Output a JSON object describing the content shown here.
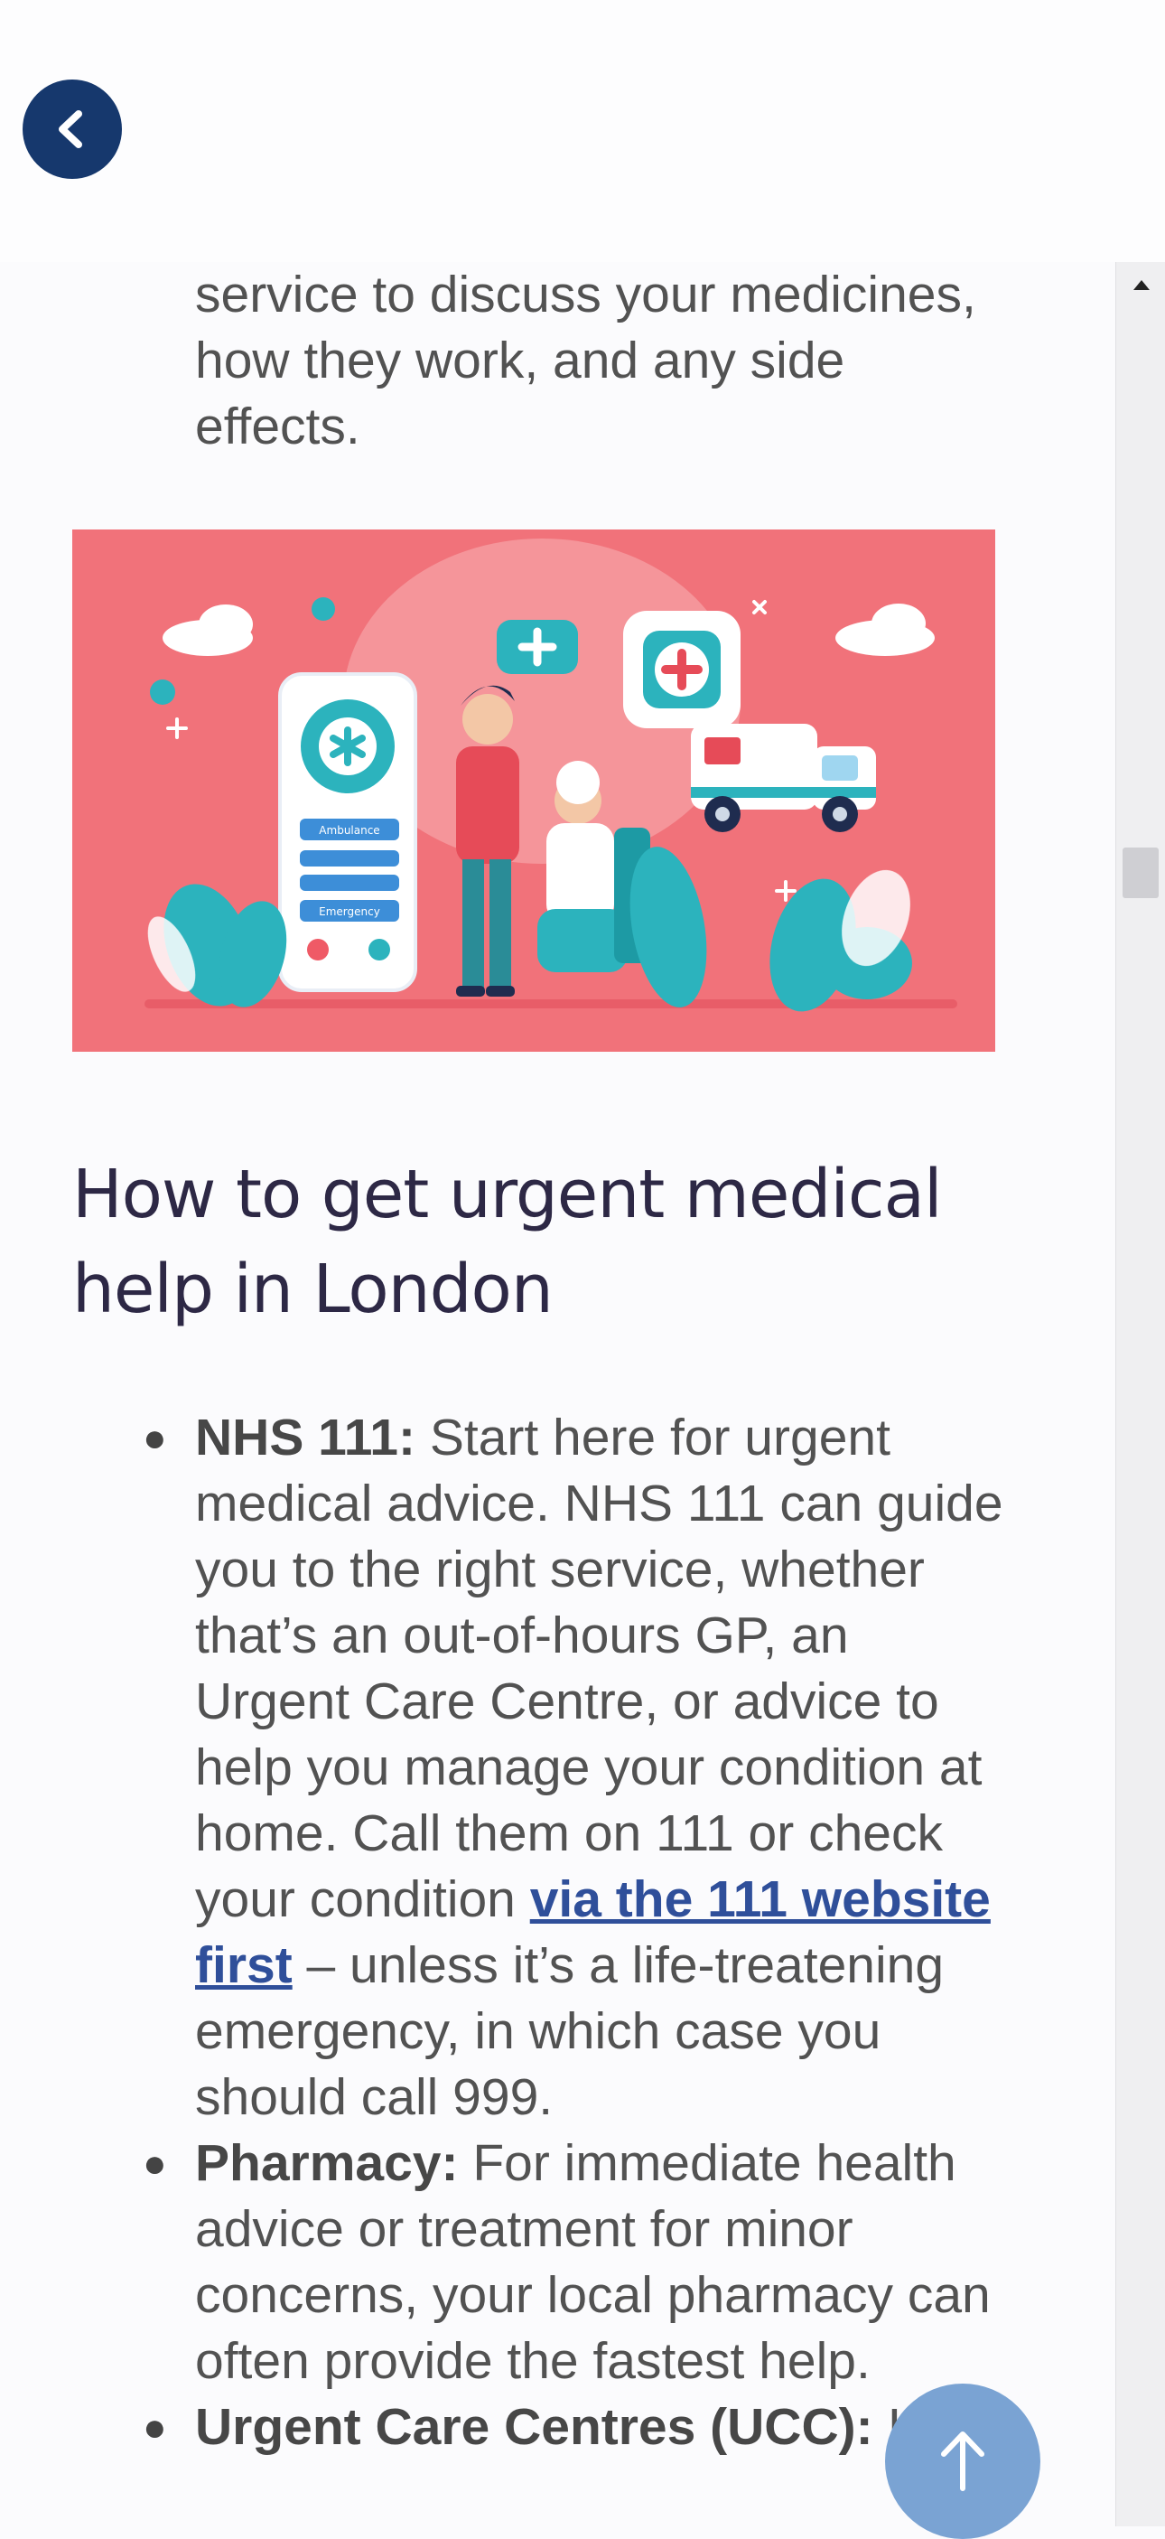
{
  "intro_text": "service to discuss your medicines, how they work, and any side effects.",
  "section": {
    "title": "How to get urgent medical help in London"
  },
  "help_items": [
    {
      "label": "NHS 111:",
      "text_before_link": " Start here for urgent medical advice. NHS 111 can guide you to the right service, whether that’s an out-of-hours GP, an Urgent Care Centre, or advice to help you manage your condition at home. Call them on 111 or check your condition ",
      "link_text": "via the 111 website first",
      "text_after_link": " – unless it’s a life-treatening emergency, in which case you should call 999."
    },
    {
      "label": "Pharmacy:",
      "text": " For immediate health advice or treatment for minor concerns, your local pharmacy can often provide the fastest help."
    },
    {
      "label": "Urgent Care Centres (UCC):",
      "text": " I"
    }
  ],
  "illustration_labels": {
    "phone_button_1": "Ambulance",
    "phone_button_2": "Emergency"
  },
  "icons": {
    "back": "chevron-left-icon",
    "top": "arrow-up-icon"
  },
  "colors": {
    "back_button": "#16386d",
    "hero_background": "#f1727a",
    "link": "#2f4f9a",
    "scroll_top_button": "#7aa3d3",
    "heading": "#2d2845"
  }
}
